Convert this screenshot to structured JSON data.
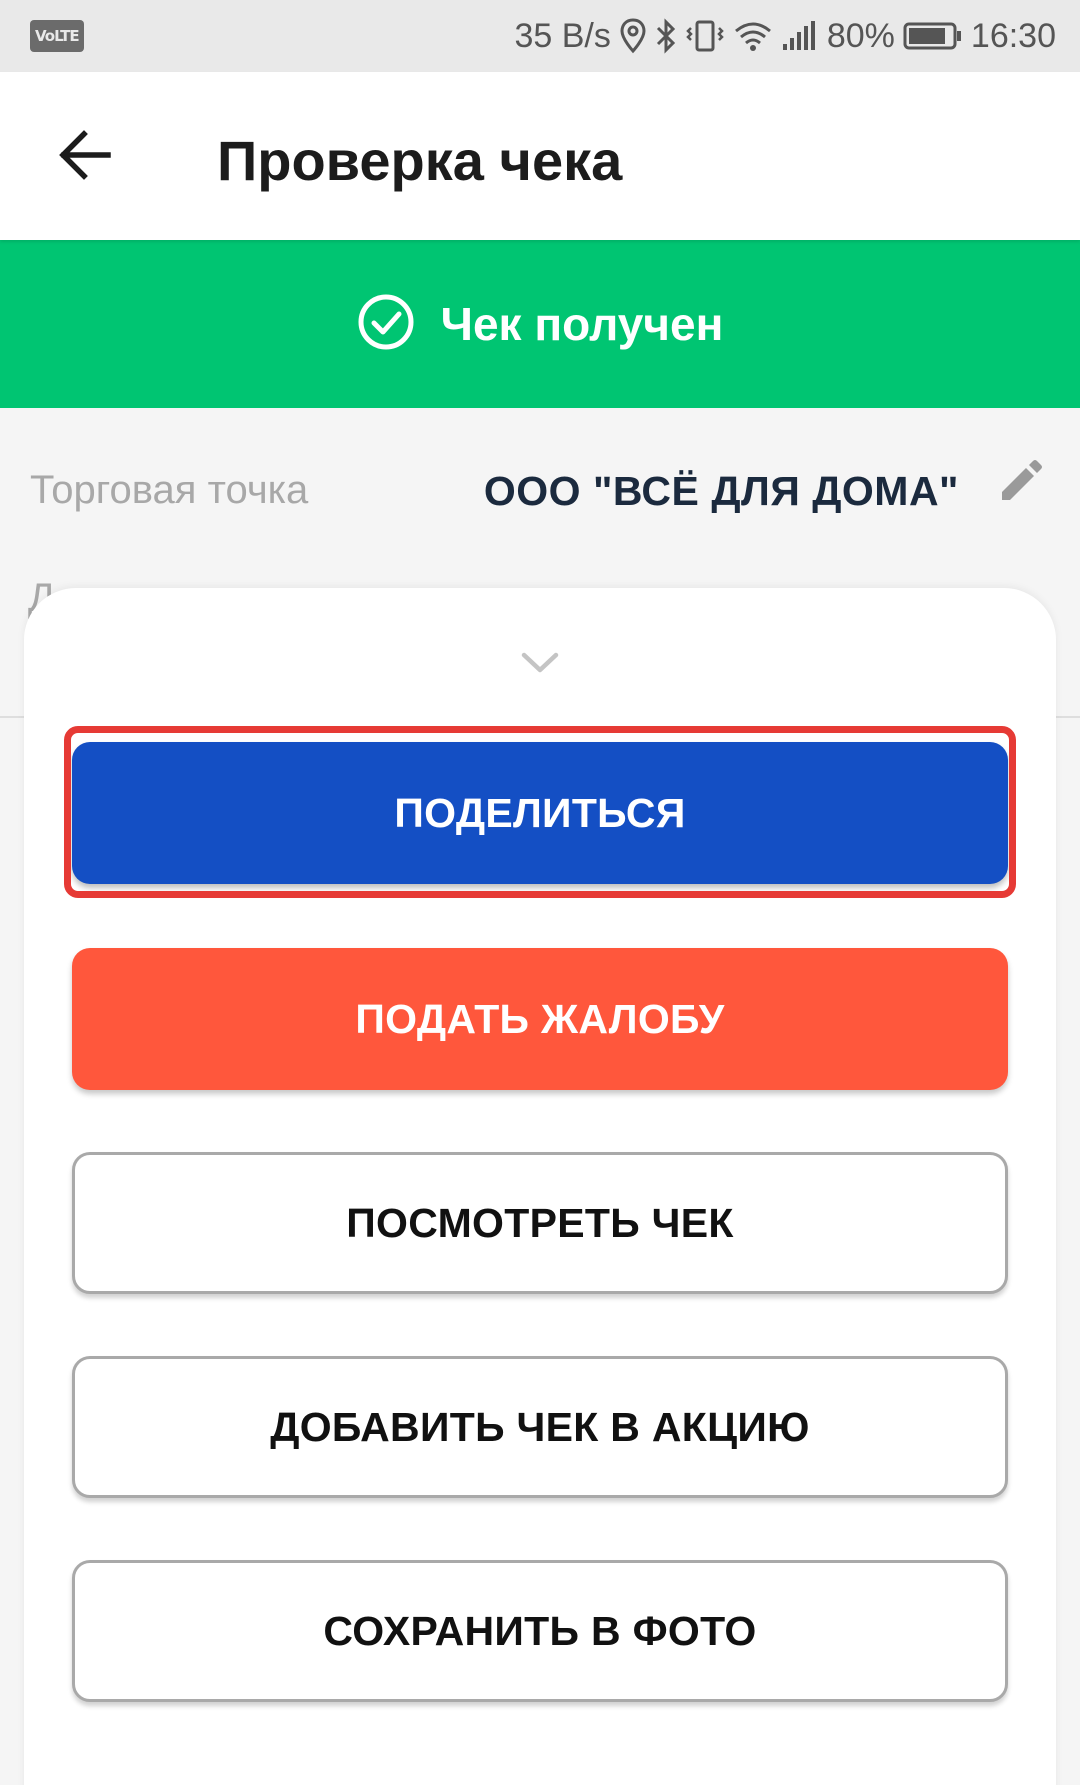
{
  "status_bar": {
    "network_badge": "VoLTE",
    "speed": "35 B/s",
    "battery": "80%",
    "time": "16:30",
    "icons": [
      "location-icon",
      "bluetooth-icon",
      "vibrate-icon",
      "wifi-icon",
      "signal-icon",
      "battery-icon"
    ]
  },
  "app_bar": {
    "title": "Проверка чека",
    "back_icon": "arrow-left-icon"
  },
  "banner": {
    "text": "Чек получен",
    "icon": "check-circle-icon",
    "color": "#00c572"
  },
  "details": {
    "store_label": "Торговая точка",
    "store_value": "ООО \"ВСЁ ДЛЯ ДОМА\"",
    "edit_icon": "pencil-icon",
    "second_label_peek": "Д"
  },
  "sheet": {
    "handle_icon": "chevron-down-icon",
    "buttons": {
      "share": "ПОДЕЛИТЬСЯ",
      "complain": "ПОДАТЬ ЖАЛОБУ",
      "view_receipt": "ПОСМОТРЕТЬ ЧЕК",
      "add_to_promo": "ДОБАВИТЬ ЧЕК В АКЦИЮ",
      "save_photo": "СОХРАНИТЬ В ФОТО"
    },
    "colors": {
      "share": "#144fc4",
      "complain": "#ff573c",
      "highlight": "#e63a35"
    }
  }
}
